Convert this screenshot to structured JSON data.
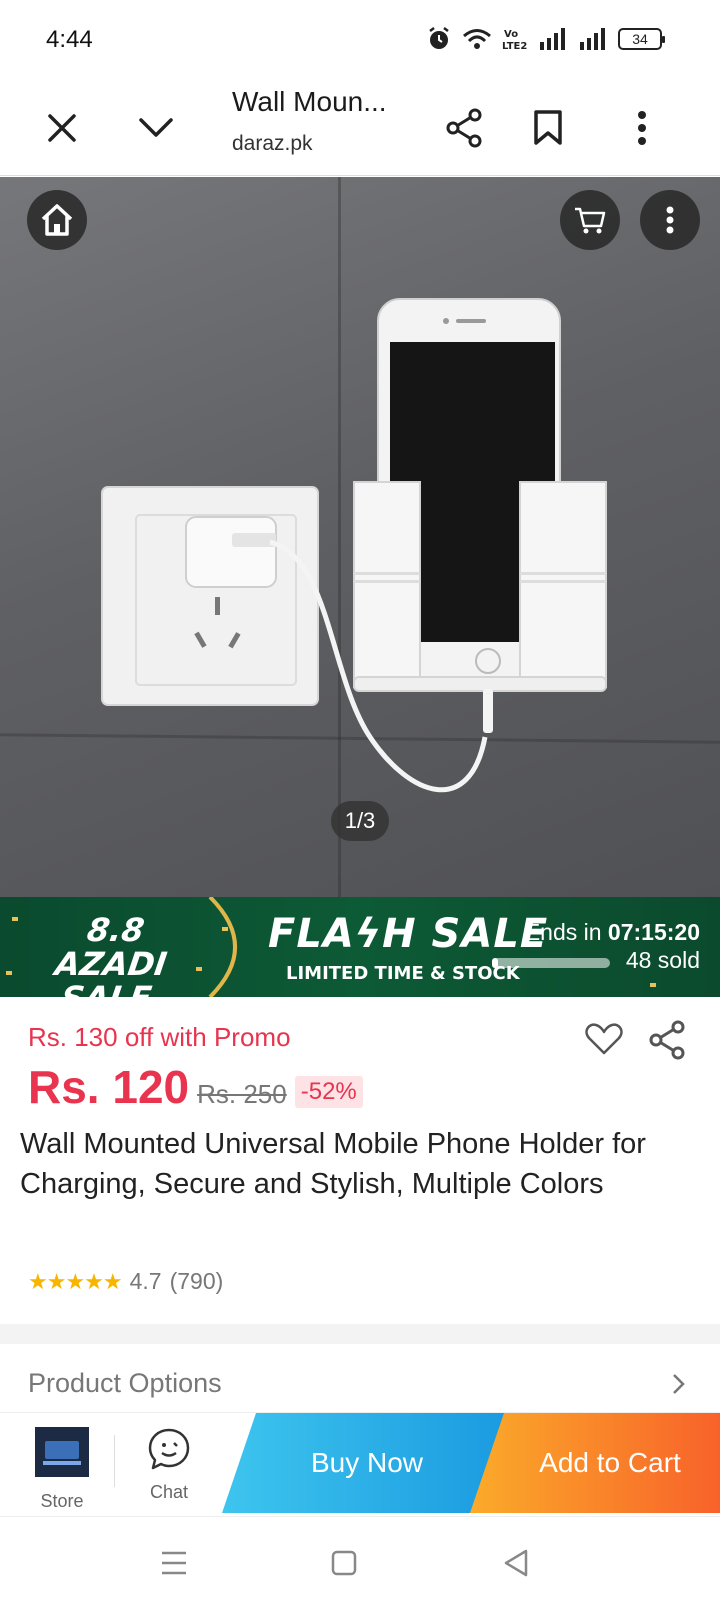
{
  "status_bar": {
    "time": "4:44",
    "battery": "34",
    "icons": [
      "alarm-icon",
      "wifi-icon",
      "volte-icon",
      "signal-icon",
      "signal-icon",
      "battery-icon"
    ]
  },
  "browser": {
    "title": "Wall Moun...",
    "domain": "daraz.pk",
    "icons": [
      "close-icon",
      "chevron-down-icon",
      "share-icon",
      "bookmark-icon",
      "more-vertical-icon"
    ]
  },
  "gallery": {
    "counter": "1/3",
    "icons": [
      "home-icon",
      "cart-icon",
      "more-vertical-icon"
    ]
  },
  "flash_sale": {
    "campaign": "8.8 AZADI SALE",
    "campaign_line1": "8.8 AZADI",
    "campaign_line2": "SALE",
    "title": "FLAϟH SALE",
    "subtitle": "LIMITED TIME & STOCK",
    "ends_label": "Ends in",
    "countdown": "07:15:20",
    "sold": "48 sold",
    "sold_progress": 0.05
  },
  "product": {
    "promo": "Rs. 130 off with Promo",
    "price": "Rs. 120",
    "original_price": "Rs. 250",
    "discount": "-52%",
    "title": "Wall Mounted Universal Mobile Phone Holder for Charging, Secure and Stylish, Multiple Colors",
    "stars": "★★★★★",
    "rating": "4.7",
    "reviews": "(790)",
    "rating_value": 4.7
  },
  "options": {
    "label": "Product Options"
  },
  "action_bar": {
    "store_label": "Store",
    "chat_label": "Chat",
    "buy_now": "Buy Now",
    "add_to_cart": "Add to Cart"
  },
  "colors": {
    "price_red": "#e8344e",
    "buy_now_blue": "#1a9ae0",
    "add_cart_orange": "#f8622a",
    "flash_green": "#0d5a36"
  }
}
